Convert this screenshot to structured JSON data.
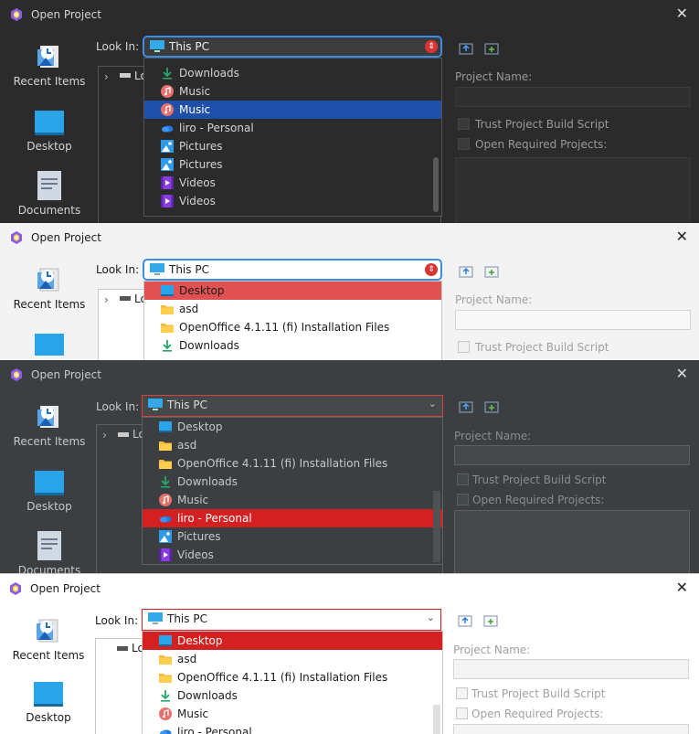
{
  "dialog": {
    "title": "Open Project",
    "close_glyph": "✕",
    "look_in_label": "Look In:",
    "look_in_value": "This PC",
    "project_name_label": "Project Name:",
    "trust_label": "Trust Project Build Script",
    "open_required_label": "Open Required Projects:",
    "tree_root": "Lo"
  },
  "sidebar": {
    "recent": "Recent Items",
    "desktop": "Desktop",
    "documents": "Documents"
  },
  "panels": [
    {
      "theme": "dark",
      "items": [
        {
          "label": "Downloads",
          "icon": "download-icon"
        },
        {
          "label": "Music",
          "icon": "music-icon"
        },
        {
          "label": "Music",
          "icon": "music-icon",
          "selected": true
        },
        {
          "label": "liro - Personal",
          "icon": "onedrive-icon"
        },
        {
          "label": "Pictures",
          "icon": "pictures-icon"
        },
        {
          "label": "Pictures",
          "icon": "pictures-icon"
        },
        {
          "label": "Videos",
          "icon": "videos-icon"
        },
        {
          "label": "Videos",
          "icon": "videos-icon"
        }
      ]
    },
    {
      "theme": "light",
      "items": [
        {
          "label": "Desktop",
          "icon": "desktop-icon",
          "selected": true
        },
        {
          "label": "asd",
          "icon": "folder-icon"
        },
        {
          "label": "OpenOffice 4.1.11 (fi) Installation Files",
          "icon": "folder-icon"
        },
        {
          "label": "Downloads",
          "icon": "download-icon"
        }
      ]
    },
    {
      "theme": "darcula",
      "items": [
        {
          "label": "Desktop",
          "icon": "desktop-icon"
        },
        {
          "label": "asd",
          "icon": "folder-icon"
        },
        {
          "label": "OpenOffice 4.1.11 (fi) Installation Files",
          "icon": "folder-icon"
        },
        {
          "label": "Downloads",
          "icon": "download-icon"
        },
        {
          "label": "Music",
          "icon": "music-icon"
        },
        {
          "label": "liro - Personal",
          "icon": "onedrive-icon",
          "selected": true
        },
        {
          "label": "Pictures",
          "icon": "pictures-icon"
        },
        {
          "label": "Videos",
          "icon": "videos-icon"
        }
      ]
    },
    {
      "theme": "white",
      "items": [
        {
          "label": "Desktop",
          "icon": "desktop-icon",
          "selected": true
        },
        {
          "label": "asd",
          "icon": "folder-icon"
        },
        {
          "label": "OpenOffice 4.1.11 (fi) Installation Files",
          "icon": "folder-icon"
        },
        {
          "label": "Downloads",
          "icon": "download-icon"
        },
        {
          "label": "Music",
          "icon": "music-icon"
        },
        {
          "label": "liro - Personal",
          "icon": "onedrive-icon"
        }
      ]
    }
  ],
  "colors": {
    "selection_blue": "#1f4fa8",
    "selection_red": "#e05252",
    "selection_red_strong": "#d42020",
    "accent_blue": "#0078d4"
  }
}
